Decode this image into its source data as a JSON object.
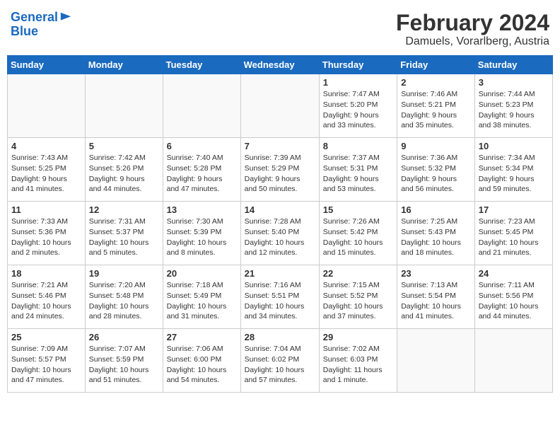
{
  "header": {
    "logo_line1": "General",
    "logo_line2": "Blue",
    "month_year": "February 2024",
    "location": "Damuels, Vorarlberg, Austria"
  },
  "weekdays": [
    "Sunday",
    "Monday",
    "Tuesday",
    "Wednesday",
    "Thursday",
    "Friday",
    "Saturday"
  ],
  "weeks": [
    [
      {
        "day": "",
        "info": ""
      },
      {
        "day": "",
        "info": ""
      },
      {
        "day": "",
        "info": ""
      },
      {
        "day": "",
        "info": ""
      },
      {
        "day": "1",
        "info": "Sunrise: 7:47 AM\nSunset: 5:20 PM\nDaylight: 9 hours\nand 33 minutes."
      },
      {
        "day": "2",
        "info": "Sunrise: 7:46 AM\nSunset: 5:21 PM\nDaylight: 9 hours\nand 35 minutes."
      },
      {
        "day": "3",
        "info": "Sunrise: 7:44 AM\nSunset: 5:23 PM\nDaylight: 9 hours\nand 38 minutes."
      }
    ],
    [
      {
        "day": "4",
        "info": "Sunrise: 7:43 AM\nSunset: 5:25 PM\nDaylight: 9 hours\nand 41 minutes."
      },
      {
        "day": "5",
        "info": "Sunrise: 7:42 AM\nSunset: 5:26 PM\nDaylight: 9 hours\nand 44 minutes."
      },
      {
        "day": "6",
        "info": "Sunrise: 7:40 AM\nSunset: 5:28 PM\nDaylight: 9 hours\nand 47 minutes."
      },
      {
        "day": "7",
        "info": "Sunrise: 7:39 AM\nSunset: 5:29 PM\nDaylight: 9 hours\nand 50 minutes."
      },
      {
        "day": "8",
        "info": "Sunrise: 7:37 AM\nSunset: 5:31 PM\nDaylight: 9 hours\nand 53 minutes."
      },
      {
        "day": "9",
        "info": "Sunrise: 7:36 AM\nSunset: 5:32 PM\nDaylight: 9 hours\nand 56 minutes."
      },
      {
        "day": "10",
        "info": "Sunrise: 7:34 AM\nSunset: 5:34 PM\nDaylight: 9 hours\nand 59 minutes."
      }
    ],
    [
      {
        "day": "11",
        "info": "Sunrise: 7:33 AM\nSunset: 5:36 PM\nDaylight: 10 hours\nand 2 minutes."
      },
      {
        "day": "12",
        "info": "Sunrise: 7:31 AM\nSunset: 5:37 PM\nDaylight: 10 hours\nand 5 minutes."
      },
      {
        "day": "13",
        "info": "Sunrise: 7:30 AM\nSunset: 5:39 PM\nDaylight: 10 hours\nand 8 minutes."
      },
      {
        "day": "14",
        "info": "Sunrise: 7:28 AM\nSunset: 5:40 PM\nDaylight: 10 hours\nand 12 minutes."
      },
      {
        "day": "15",
        "info": "Sunrise: 7:26 AM\nSunset: 5:42 PM\nDaylight: 10 hours\nand 15 minutes."
      },
      {
        "day": "16",
        "info": "Sunrise: 7:25 AM\nSunset: 5:43 PM\nDaylight: 10 hours\nand 18 minutes."
      },
      {
        "day": "17",
        "info": "Sunrise: 7:23 AM\nSunset: 5:45 PM\nDaylight: 10 hours\nand 21 minutes."
      }
    ],
    [
      {
        "day": "18",
        "info": "Sunrise: 7:21 AM\nSunset: 5:46 PM\nDaylight: 10 hours\nand 24 minutes."
      },
      {
        "day": "19",
        "info": "Sunrise: 7:20 AM\nSunset: 5:48 PM\nDaylight: 10 hours\nand 28 minutes."
      },
      {
        "day": "20",
        "info": "Sunrise: 7:18 AM\nSunset: 5:49 PM\nDaylight: 10 hours\nand 31 minutes."
      },
      {
        "day": "21",
        "info": "Sunrise: 7:16 AM\nSunset: 5:51 PM\nDaylight: 10 hours\nand 34 minutes."
      },
      {
        "day": "22",
        "info": "Sunrise: 7:15 AM\nSunset: 5:52 PM\nDaylight: 10 hours\nand 37 minutes."
      },
      {
        "day": "23",
        "info": "Sunrise: 7:13 AM\nSunset: 5:54 PM\nDaylight: 10 hours\nand 41 minutes."
      },
      {
        "day": "24",
        "info": "Sunrise: 7:11 AM\nSunset: 5:56 PM\nDaylight: 10 hours\nand 44 minutes."
      }
    ],
    [
      {
        "day": "25",
        "info": "Sunrise: 7:09 AM\nSunset: 5:57 PM\nDaylight: 10 hours\nand 47 minutes."
      },
      {
        "day": "26",
        "info": "Sunrise: 7:07 AM\nSunset: 5:59 PM\nDaylight: 10 hours\nand 51 minutes."
      },
      {
        "day": "27",
        "info": "Sunrise: 7:06 AM\nSunset: 6:00 PM\nDaylight: 10 hours\nand 54 minutes."
      },
      {
        "day": "28",
        "info": "Sunrise: 7:04 AM\nSunset: 6:02 PM\nDaylight: 10 hours\nand 57 minutes."
      },
      {
        "day": "29",
        "info": "Sunrise: 7:02 AM\nSunset: 6:03 PM\nDaylight: 11 hours\nand 1 minute."
      },
      {
        "day": "",
        "info": ""
      },
      {
        "day": "",
        "info": ""
      }
    ]
  ]
}
